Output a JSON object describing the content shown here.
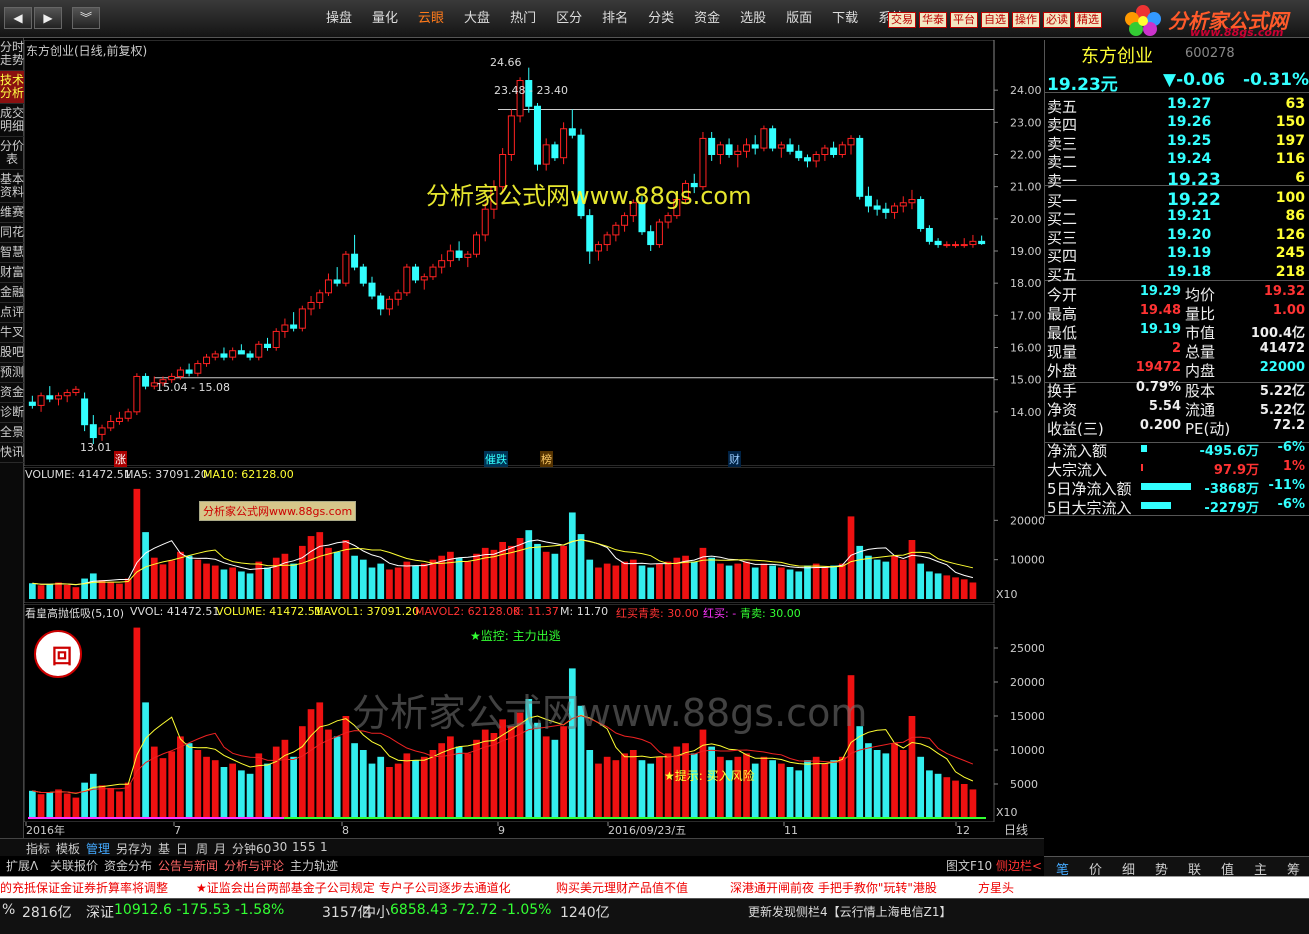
{
  "topbar": {
    "menu": [
      "操盘",
      "量化",
      "云眼",
      "大盘",
      "热门",
      "区分",
      "排名",
      "分类",
      "资金",
      "选股",
      "版面",
      "下载",
      "系统"
    ],
    "active_menu": "云眼",
    "tools": [
      "交易",
      "华泰",
      "平台",
      "自选",
      "操作",
      "必读",
      "精选"
    ],
    "logo_title": "分析家公式网",
    "logo_url": "www.88gs.com"
  },
  "sidetabs": [
    "分时走势",
    "技术分析",
    "成交明细",
    "分价表",
    "基本资料",
    "维赛",
    "同花",
    "智慧",
    "财富",
    "金融",
    "点评",
    "牛叉",
    "股吧",
    "预测",
    "资金",
    "诊断",
    "全景",
    "快讯"
  ],
  "active_sidetab": "技术分析",
  "chart_title": "东方创业(日线,前复权)",
  "watermark_main": "分析家公式网www.88gs.com",
  "watermark_small": "分析家公式网www.88gs.com",
  "watermark_ind": "分析家公式网www.88gs.com",
  "price_labels": {
    "high": "24.66",
    "range_top": "23.48 - 23.40",
    "range_bottom": "15.04 - 15.08",
    "low": "13.01"
  },
  "markers": [
    "涨",
    "催跌",
    "榜",
    "财"
  ],
  "vol_legend": {
    "v": "VOLUME: 41472.51",
    "ma5": "MA5: 37091.20",
    "ma10": "MA10: 62128.00"
  },
  "vol_x10": "X10",
  "ind_legend": {
    "name": "看皇高抛低吸(5,10)",
    "vvol": "VVOL: 41472.51",
    "volume": "VOLUME: 41472.51",
    "mavol1": "MAVOL1: 37091.20",
    "mavol2": "MAVOL2: 62128.00",
    "k": "K: 11.37",
    "m": "M: 11.70",
    "hm": "红买青卖: 30.00",
    "hb": "红买: -",
    "qm": "青卖: 30.00"
  },
  "ind_badge": "回",
  "ind_annot1": "★监控: 主力出逃",
  "ind_annot2": "★提示: 买入风险",
  "ind_x10": "X10",
  "xaxis": {
    "labels": [
      "2016年",
      "7",
      "8",
      "9",
      "2016/09/23/五",
      "11",
      "12"
    ],
    "period": "日线"
  },
  "chart_data": [
    {
      "type": "candlestick",
      "title": "东方创业(日线,前复权)",
      "ylim": [
        13.0,
        25.0
      ],
      "yticks": [
        "24.00",
        "23.00",
        "22.00",
        "21.00",
        "20.00",
        "19.00",
        "18.00",
        "17.00",
        "16.00",
        "15.00",
        "14.00"
      ],
      "candles": [
        [
          14.3,
          14.5,
          14.1,
          14.2
        ],
        [
          14.2,
          14.6,
          14.0,
          14.5
        ],
        [
          14.5,
          14.8,
          14.3,
          14.4
        ],
        [
          14.4,
          14.6,
          14.2,
          14.5
        ],
        [
          14.5,
          14.7,
          14.3,
          14.6
        ],
        [
          14.6,
          14.8,
          14.5,
          14.7
        ],
        [
          14.4,
          14.6,
          13.4,
          13.6
        ],
        [
          13.6,
          13.9,
          13.0,
          13.2
        ],
        [
          13.3,
          13.6,
          13.1,
          13.5
        ],
        [
          13.5,
          13.9,
          13.4,
          13.7
        ],
        [
          13.7,
          14.0,
          13.6,
          13.8
        ],
        [
          13.8,
          14.1,
          13.7,
          14.0
        ],
        [
          14.0,
          15.2,
          13.9,
          15.1
        ],
        [
          15.1,
          15.2,
          14.7,
          14.8
        ],
        [
          14.8,
          15.1,
          14.7,
          14.9
        ],
        [
          14.9,
          15.1,
          14.8,
          15.0
        ],
        [
          15.0,
          15.2,
          14.9,
          15.1
        ],
        [
          15.1,
          15.4,
          15.0,
          15.3
        ],
        [
          15.3,
          15.5,
          15.1,
          15.2
        ],
        [
          15.2,
          15.6,
          15.1,
          15.5
        ],
        [
          15.5,
          15.8,
          15.4,
          15.7
        ],
        [
          15.7,
          15.9,
          15.6,
          15.8
        ],
        [
          15.8,
          16.0,
          15.6,
          15.7
        ],
        [
          15.7,
          16.0,
          15.6,
          15.9
        ],
        [
          15.9,
          16.1,
          15.8,
          15.8
        ],
        [
          15.8,
          15.9,
          15.6,
          15.7
        ],
        [
          15.7,
          16.2,
          15.6,
          16.1
        ],
        [
          16.1,
          16.3,
          15.9,
          16.0
        ],
        [
          16.0,
          16.6,
          15.9,
          16.5
        ],
        [
          16.5,
          16.9,
          16.3,
          16.7
        ],
        [
          16.7,
          17.1,
          16.5,
          16.6
        ],
        [
          16.6,
          17.3,
          16.5,
          17.2
        ],
        [
          17.2,
          17.6,
          17.0,
          17.4
        ],
        [
          17.4,
          17.8,
          17.2,
          17.7
        ],
        [
          17.7,
          18.3,
          17.6,
          18.1
        ],
        [
          18.1,
          18.5,
          17.9,
          18.0
        ],
        [
          18.0,
          19.0,
          17.9,
          18.9
        ],
        [
          18.9,
          19.5,
          18.4,
          18.5
        ],
        [
          18.5,
          18.6,
          17.9,
          18.0
        ],
        [
          18.0,
          18.2,
          17.5,
          17.6
        ],
        [
          17.6,
          17.7,
          17.0,
          17.2
        ],
        [
          17.2,
          17.6,
          17.0,
          17.5
        ],
        [
          17.5,
          17.8,
          17.3,
          17.7
        ],
        [
          17.7,
          18.6,
          17.6,
          18.5
        ],
        [
          18.5,
          18.6,
          18.0,
          18.1
        ],
        [
          18.1,
          18.3,
          17.8,
          18.2
        ],
        [
          18.2,
          18.6,
          18.1,
          18.5
        ],
        [
          18.5,
          18.9,
          18.3,
          18.7
        ],
        [
          18.7,
          19.2,
          18.5,
          19.0
        ],
        [
          19.0,
          19.3,
          18.7,
          18.8
        ],
        [
          18.8,
          19.0,
          18.5,
          18.9
        ],
        [
          18.9,
          19.6,
          18.8,
          19.5
        ],
        [
          19.5,
          20.5,
          19.3,
          20.3
        ],
        [
          20.3,
          21.2,
          20.0,
          21.0
        ],
        [
          21.0,
          22.2,
          20.8,
          22.0
        ],
        [
          22.0,
          23.4,
          21.8,
          23.2
        ],
        [
          23.2,
          24.4,
          23.0,
          24.3
        ],
        [
          24.3,
          24.7,
          23.3,
          23.5
        ],
        [
          23.5,
          23.6,
          21.5,
          21.7
        ],
        [
          21.7,
          22.5,
          21.5,
          22.3
        ],
        [
          22.3,
          22.4,
          21.8,
          21.9
        ],
        [
          21.9,
          23.0,
          21.7,
          22.8
        ],
        [
          22.8,
          23.4,
          22.5,
          22.6
        ],
        [
          22.6,
          22.8,
          20.0,
          20.1
        ],
        [
          20.1,
          20.3,
          18.6,
          19.0
        ],
        [
          19.0,
          19.3,
          18.7,
          19.2
        ],
        [
          19.2,
          19.6,
          19.0,
          19.5
        ],
        [
          19.5,
          19.9,
          19.3,
          19.8
        ],
        [
          19.8,
          20.2,
          19.6,
          20.1
        ],
        [
          20.1,
          20.6,
          19.9,
          20.5
        ],
        [
          20.5,
          20.7,
          19.5,
          19.6
        ],
        [
          19.6,
          19.8,
          19.0,
          19.2
        ],
        [
          19.2,
          20.0,
          19.1,
          19.9
        ],
        [
          19.9,
          20.2,
          19.7,
          20.1
        ],
        [
          20.1,
          20.7,
          20.0,
          20.6
        ],
        [
          20.6,
          21.2,
          20.5,
          21.1
        ],
        [
          21.1,
          21.4,
          20.8,
          21.0
        ],
        [
          21.0,
          22.7,
          20.9,
          22.5
        ],
        [
          22.5,
          22.7,
          21.8,
          22.0
        ],
        [
          22.0,
          22.4,
          21.7,
          22.3
        ],
        [
          22.3,
          22.5,
          21.9,
          22.0
        ],
        [
          22.0,
          22.3,
          21.6,
          22.1
        ],
        [
          22.1,
          22.5,
          21.9,
          22.3
        ],
        [
          22.3,
          22.6,
          22.0,
          22.2
        ],
        [
          22.2,
          22.9,
          22.1,
          22.8
        ],
        [
          22.8,
          22.9,
          22.1,
          22.2
        ],
        [
          22.2,
          22.4,
          21.9,
          22.3
        ],
        [
          22.3,
          22.5,
          22.0,
          22.1
        ],
        [
          22.1,
          22.3,
          21.8,
          21.9
        ],
        [
          21.9,
          22.0,
          21.6,
          21.8
        ],
        [
          21.8,
          22.1,
          21.6,
          22.0
        ],
        [
          22.0,
          22.3,
          21.8,
          22.2
        ],
        [
          22.2,
          22.4,
          21.9,
          22.0
        ],
        [
          22.0,
          22.4,
          21.9,
          22.3
        ],
        [
          22.3,
          22.6,
          22.0,
          22.5
        ],
        [
          22.5,
          22.6,
          20.6,
          20.7
        ],
        [
          20.7,
          21.0,
          20.2,
          20.4
        ],
        [
          20.4,
          20.6,
          20.1,
          20.3
        ],
        [
          20.3,
          20.5,
          20.0,
          20.2
        ],
        [
          20.2,
          20.5,
          20.0,
          20.4
        ],
        [
          20.4,
          20.7,
          20.2,
          20.5
        ],
        [
          20.5,
          20.9,
          20.3,
          20.6
        ],
        [
          20.6,
          20.7,
          19.6,
          19.7
        ],
        [
          19.7,
          19.8,
          19.2,
          19.3
        ],
        [
          19.3,
          19.4,
          19.1,
          19.2
        ],
        [
          19.2,
          19.3,
          19.1,
          19.2
        ],
        [
          19.2,
          19.3,
          19.1,
          19.2
        ],
        [
          19.2,
          19.4,
          19.1,
          19.2
        ],
        [
          19.2,
          19.5,
          19.1,
          19.3
        ],
        [
          19.3,
          19.48,
          19.19,
          19.23
        ]
      ]
    },
    {
      "type": "bar",
      "title": "VOLUME",
      "ylim": [
        0,
        30000
      ],
      "yticks": [
        "20000",
        "10000"
      ],
      "volume": [
        4000,
        3500,
        3800,
        4200,
        3600,
        3000,
        5200,
        6500,
        4800,
        4400,
        3900,
        5200,
        28000,
        17000,
        10500,
        8800,
        9800,
        12000,
        11000,
        10000,
        9000,
        8500,
        7500,
        8000,
        7000,
        6500,
        9500,
        8000,
        10500,
        11500,
        9000,
        13500,
        16000,
        17000,
        13000,
        12000,
        15000,
        11000,
        10000,
        8000,
        9000,
        7500,
        8000,
        9500,
        8500,
        9000,
        10000,
        11000,
        12000,
        10500,
        9500,
        11500,
        13000,
        12500,
        14500,
        13500,
        15500,
        17500,
        14000,
        12000,
        11500,
        13500,
        22000,
        16500,
        10000,
        8000,
        9000,
        8500,
        9500,
        10000,
        8500,
        8000,
        9000,
        9500,
        10500,
        11000,
        9500,
        13000,
        10500,
        9000,
        8500,
        9000,
        9500,
        8000,
        9000,
        8500,
        8000,
        7500,
        7000,
        8500,
        9000,
        8000,
        8500,
        9000,
        21000,
        13500,
        11000,
        10000,
        9500,
        11000,
        10000,
        15000,
        9000,
        7000,
        6500,
        6000,
        5500,
        5000,
        4200
      ]
    },
    {
      "type": "bar",
      "title": "看皇高抛低吸(5,10)",
      "ylim": [
        0,
        30000
      ],
      "yticks": [
        "25000",
        "20000",
        "15000",
        "10000",
        "5000"
      ]
    }
  ],
  "quote": {
    "name": "东方创业",
    "code": "600278",
    "price": "19.23元",
    "change": "▼-0.06",
    "pct": "-0.31%",
    "asks": [
      [
        "卖五",
        "19.27",
        "63"
      ],
      [
        "卖四",
        "19.26",
        "150"
      ],
      [
        "卖三",
        "19.25",
        "197"
      ],
      [
        "卖二",
        "19.24",
        "116"
      ],
      [
        "卖一",
        "19.23",
        "6"
      ]
    ],
    "bids": [
      [
        "买一",
        "19.22",
        "100"
      ],
      [
        "买二",
        "19.21",
        "86"
      ],
      [
        "买三",
        "19.20",
        "126"
      ],
      [
        "买四",
        "19.19",
        "245"
      ],
      [
        "买五",
        "19.18",
        "218"
      ]
    ],
    "stats": [
      [
        "今开",
        "19.29",
        "均价",
        "19.32"
      ],
      [
        "最高",
        "19.48",
        "量比",
        "1.00"
      ],
      [
        "最低",
        "19.19",
        "市值",
        "100.4亿"
      ],
      [
        "现量",
        "2",
        "总量",
        "41472"
      ],
      [
        "外盘",
        "19472",
        "内盘",
        "22000"
      ]
    ],
    "stats2": [
      [
        "换手",
        "0.79%",
        "股本",
        "5.22亿"
      ],
      [
        "净资",
        "5.54",
        "流通",
        "5.22亿"
      ],
      [
        "收益(三)",
        "0.200",
        "PE(动)",
        "72.2"
      ]
    ],
    "flows": [
      [
        "净流入额",
        "-495.6万",
        "-6%"
      ],
      [
        "大宗流入",
        "97.9万",
        "1%"
      ],
      [
        "5日净流入额",
        "-3868万",
        "-11%"
      ],
      [
        "5日大宗流入",
        "-2279万",
        "-6%"
      ]
    ]
  },
  "bottombar": [
    "指标",
    "模板",
    "管理",
    "另存为",
    "基",
    "日",
    "周",
    "月",
    "分钟60",
    "30",
    "15",
    "5",
    "1"
  ],
  "bottombar2": [
    "扩展Λ",
    "关联报价",
    "资金分布",
    "公告与新闻",
    "分析与评论",
    "主力轨迹"
  ],
  "bottombar_right": [
    "图文F10",
    "侧边栏<"
  ],
  "rtabs": [
    "笔",
    "价",
    "细",
    "势",
    "联",
    "值",
    "主",
    "筹"
  ],
  "news": [
    "的充抵保证金证券折算率将调整",
    "★证监会出台两部基金子公司规定 专户子公司逐步去通道化",
    "购买美元理财产品值不值",
    "深港通开闸前夜 手把手教你\"玩转\"港股",
    "方星头"
  ],
  "ticker": {
    "items": [
      [
        "%",
        "",
        "2816亿"
      ],
      [
        "深证",
        "10912.6 -175.53 -1.58%",
        "3157亿"
      ],
      [
        "中小",
        "6858.43 -72.72 -1.05%",
        "1240亿"
      ]
    ],
    "status": "更新发现侧栏4【云行情上海电信Z1】"
  }
}
